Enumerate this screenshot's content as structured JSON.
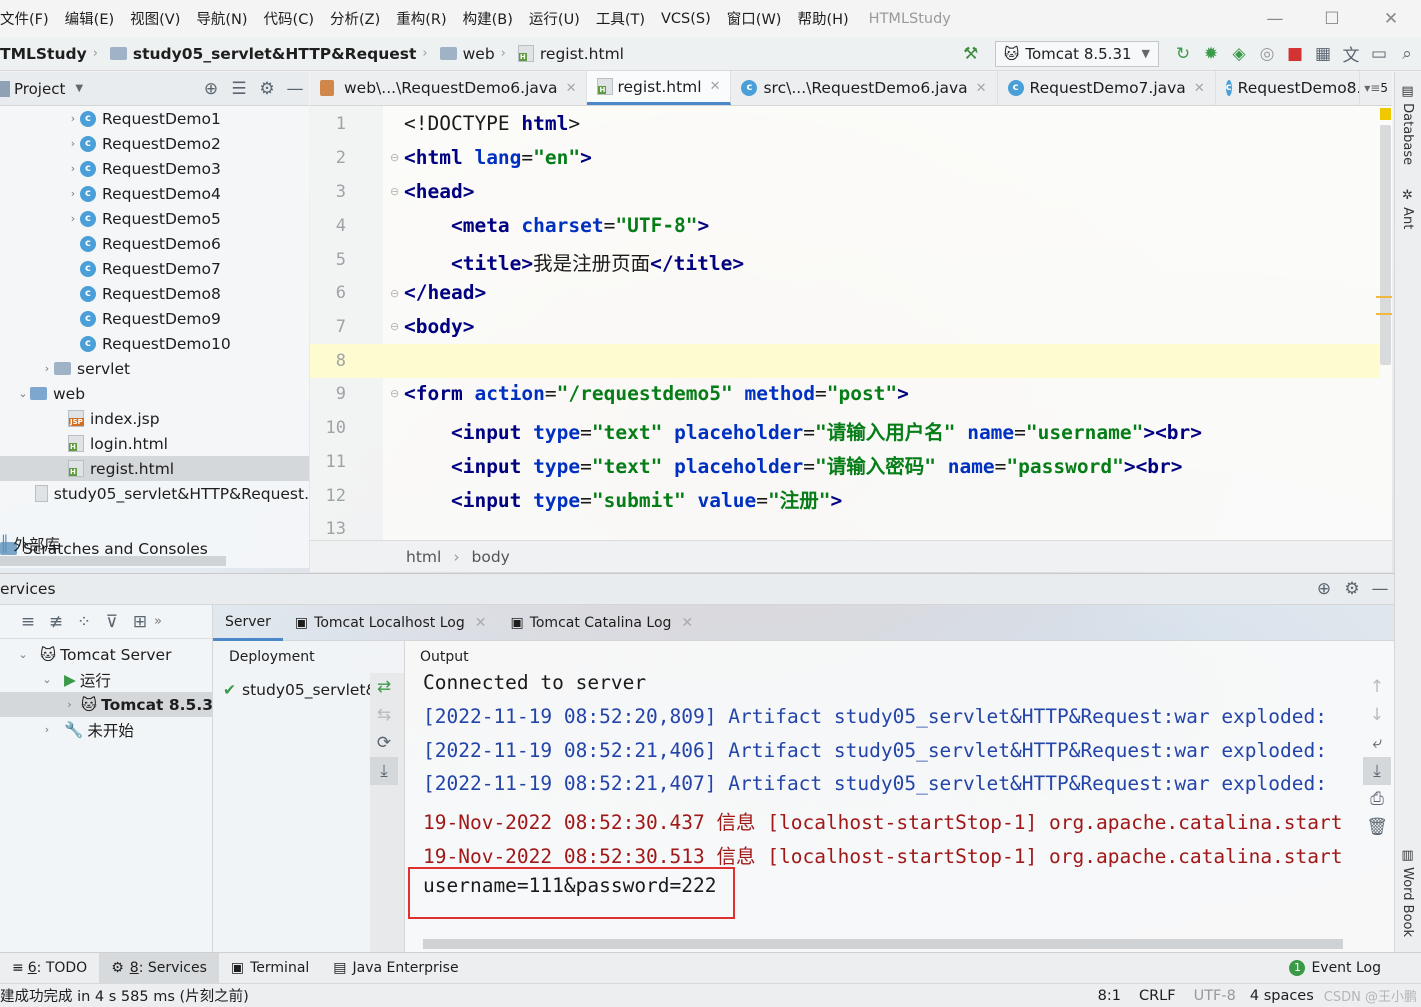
{
  "menu": [
    "文件(F)",
    "编辑(E)",
    "视图(V)",
    "导航(N)",
    "代码(C)",
    "分析(Z)",
    "重构(R)",
    "构建(B)",
    "运行(U)",
    "工具(T)",
    "VCS(S)",
    "窗口(W)",
    "帮助(H)"
  ],
  "app_title": "HTMLStudy",
  "breadcrumb": {
    "project": "TMLStudy",
    "module": "study05_servlet&HTTP&Request",
    "folder": "web",
    "file": "regist.html"
  },
  "run_config": "Tomcat 8.5.31",
  "project_panel": {
    "title": "Project"
  },
  "tree": {
    "items": [
      "RequestDemo1",
      "RequestDemo2",
      "RequestDemo3",
      "RequestDemo4",
      "RequestDemo5",
      "RequestDemo6",
      "RequestDemo7",
      "RequestDemo8",
      "RequestDemo9",
      "RequestDemo10"
    ],
    "servlet": "servlet",
    "web": "web",
    "index": "index.jsp",
    "login": "login.html",
    "regist": "regist.html",
    "iml": "study05_servlet&HTTP&Request.",
    "scratches": "Scratches and Consoles",
    "external": "外部库"
  },
  "tabs": [
    "web\\...\\RequestDemo6.java",
    "regist.html",
    "src\\...\\RequestDemo6.java",
    "RequestDemo7.java",
    "RequestDemo8.ja"
  ],
  "tab_overflow": "5",
  "line_numbers": [
    "1",
    "2",
    "3",
    "4",
    "5",
    "6",
    "7",
    "8",
    "9",
    "10",
    "11",
    "12",
    "13"
  ],
  "code": {
    "l5_title_text": "我是注册页面",
    "l9_action": "\"/requestdemo5\"",
    "l9_method": "\"post\"",
    "l10_placeholder": "\"请输入用户名\"",
    "l10_name": "\"username\"",
    "l11_placeholder": "\"请输入密码\"",
    "l11_name": "\"password\"",
    "l12_value": "\"注册\""
  },
  "editor_breadcrumb": [
    "html",
    "body"
  ],
  "right_strip": {
    "database": "Database",
    "ant": "Ant",
    "wordbook": "Word Book"
  },
  "services": {
    "title": "ervices",
    "tabs": [
      "Server",
      "Tomcat Localhost Log",
      "Tomcat Catalina Log"
    ],
    "tree": {
      "root": "Tomcat Server",
      "running": "运行",
      "instance": "Tomcat 8.5.3",
      "stopped": "未开始"
    },
    "deployment_header": "Deployment",
    "deployment_item": "study05_servlet&",
    "output_header": "Output",
    "output": [
      "Connected to server",
      "[2022-11-19 08:52:20,809] Artifact study05_servlet&HTTP&Request:war exploded:",
      "[2022-11-19 08:52:21,406] Artifact study05_servlet&HTTP&Request:war exploded:",
      "[2022-11-19 08:52:21,407] Artifact study05_servlet&HTTP&Request:war exploded:",
      "19-Nov-2022 08:52:30.437 信息 [localhost-startStop-1] org.apache.catalina.start",
      "19-Nov-2022 08:52:30.513 信息 [localhost-startStop-1] org.apache.catalina.start",
      "username=111&password=222"
    ]
  },
  "bottom_tabs": {
    "todo_num": "6",
    "todo": ": TODO",
    "services_num": "8",
    "services": ": Services",
    "terminal": "Terminal",
    "java_ee": "Java Enterprise",
    "event_log": "Event Log",
    "event_count": "1"
  },
  "status": {
    "message": "建成功完成 in 4 s 585 ms (片刻之前)",
    "position": "8:1",
    "line_sep": "CRLF",
    "encoding": "UTF-8",
    "indent": "4 spaces",
    "watermark": "CSDN @王小鹏"
  }
}
